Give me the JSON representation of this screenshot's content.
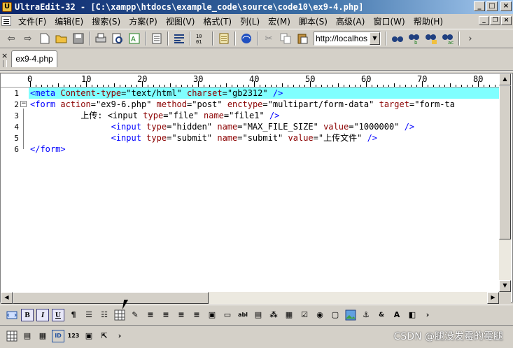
{
  "window": {
    "title": "UltraEdit-32 - [C:\\xampp\\htdocs\\example_code\\source\\code10\\ex9-4.php]",
    "app_icon_letter": "U",
    "controls": {
      "minimize": "_",
      "maximize": "□",
      "close": "×"
    },
    "mdi_controls": {
      "minimize": "_",
      "restore": "❐",
      "close": "×"
    }
  },
  "menu": [
    "文件(F)",
    "编辑(E)",
    "搜索(S)",
    "方案(P)",
    "视图(V)",
    "格式(T)",
    "列(L)",
    "宏(M)",
    "脚本(S)",
    "高级(A)",
    "窗口(W)",
    "帮助(H)"
  ],
  "toolbar": {
    "url_value": "http://localhos",
    "icons": [
      "back-icon",
      "forward-icon",
      "new-file-icon",
      "open-folder-icon",
      "save-icon",
      "print-icon",
      "print-preview-icon",
      "spell-check-icon",
      "page-icon",
      "word-wrap-icon",
      "hex-icon",
      "ftp-icon",
      "browser-icon",
      "cut-icon",
      "copy-icon",
      "paste-icon",
      "find-icon",
      "replace-icon",
      "find-files-icon",
      "replace-files-icon",
      "more-icon"
    ]
  },
  "tabs": [
    {
      "label": "ex9-4.php",
      "active": true
    }
  ],
  "tab_close": "×",
  "ruler": {
    "marks": [
      "0",
      "10",
      "20",
      "30",
      "40",
      "50",
      "60",
      "70",
      "80"
    ]
  },
  "editor": {
    "line_numbers": [
      "1",
      "2",
      "3",
      "4",
      "5",
      "6"
    ],
    "fold_marker": "−",
    "lines": [
      {
        "highlighted": true,
        "tokens": [
          {
            "t": "tg",
            "v": "<meta "
          },
          {
            "t": "at",
            "v": "Content-type"
          },
          {
            "t": "eq",
            "v": "="
          },
          {
            "t": "vl",
            "v": "\"text/html\" "
          },
          {
            "t": "at",
            "v": "charset"
          },
          {
            "t": "eq",
            "v": "="
          },
          {
            "t": "vl",
            "v": "\"gb2312\" "
          },
          {
            "t": "tg",
            "v": "/>"
          }
        ]
      },
      {
        "highlighted": false,
        "tokens": [
          {
            "t": "tg",
            "v": "<form "
          },
          {
            "t": "at",
            "v": "action"
          },
          {
            "t": "eq",
            "v": "="
          },
          {
            "t": "vl",
            "v": "\"ex9-6.php\" "
          },
          {
            "t": "at",
            "v": "method"
          },
          {
            "t": "eq",
            "v": "="
          },
          {
            "t": "vl",
            "v": "\"post\" "
          },
          {
            "t": "at",
            "v": "enctype"
          },
          {
            "t": "eq",
            "v": "="
          },
          {
            "t": "vl",
            "v": "\"multipart/form-data\" "
          },
          {
            "t": "at",
            "v": "target"
          },
          {
            "t": "eq",
            "v": "="
          },
          {
            "t": "vl",
            "v": "\"form-ta"
          }
        ]
      },
      {
        "highlighted": false,
        "tokens": [
          {
            "t": "tx",
            "v": "          上传: <input "
          },
          {
            "t": "at",
            "v": "type"
          },
          {
            "t": "eq",
            "v": "="
          },
          {
            "t": "vl",
            "v": "\"file\" "
          },
          {
            "t": "at",
            "v": "name"
          },
          {
            "t": "eq",
            "v": "="
          },
          {
            "t": "vl",
            "v": "\"file1\" "
          },
          {
            "t": "tg",
            "v": "/>"
          }
        ]
      },
      {
        "highlighted": false,
        "tokens": [
          {
            "t": "tx",
            "v": "                "
          },
          {
            "t": "tg",
            "v": "<input "
          },
          {
            "t": "at",
            "v": "type"
          },
          {
            "t": "eq",
            "v": "="
          },
          {
            "t": "vl",
            "v": "\"hidden\" "
          },
          {
            "t": "at",
            "v": "name"
          },
          {
            "t": "eq",
            "v": "="
          },
          {
            "t": "vl",
            "v": "\"MAX_FILE_SIZE\" "
          },
          {
            "t": "at",
            "v": "value"
          },
          {
            "t": "eq",
            "v": "="
          },
          {
            "t": "vl",
            "v": "\"1000000\" "
          },
          {
            "t": "tg",
            "v": "/>"
          }
        ]
      },
      {
        "highlighted": false,
        "tokens": [
          {
            "t": "tx",
            "v": "                "
          },
          {
            "t": "tg",
            "v": "<input "
          },
          {
            "t": "at",
            "v": "type"
          },
          {
            "t": "eq",
            "v": "="
          },
          {
            "t": "vl",
            "v": "\"submit\" "
          },
          {
            "t": "at",
            "v": "name"
          },
          {
            "t": "eq",
            "v": "="
          },
          {
            "t": "vl",
            "v": "\"submit\" "
          },
          {
            "t": "at",
            "v": "value"
          },
          {
            "t": "eq",
            "v": "="
          },
          {
            "t": "vl",
            "v": "\"上传文件\" "
          },
          {
            "t": "tg",
            "v": "/>"
          }
        ]
      },
      {
        "highlighted": false,
        "tokens": [
          {
            "t": "tg",
            "v": "</form>"
          }
        ]
      }
    ]
  },
  "bottom_toolbar_1": [
    "B",
    "I",
    "U"
  ],
  "watermark": "CSDN @腿没发霉的霉腿",
  "colors": {
    "highlight": "#80ffff",
    "tag": "#0000ff",
    "attribute": "#8b0000",
    "titlebar": "#0a246a"
  }
}
